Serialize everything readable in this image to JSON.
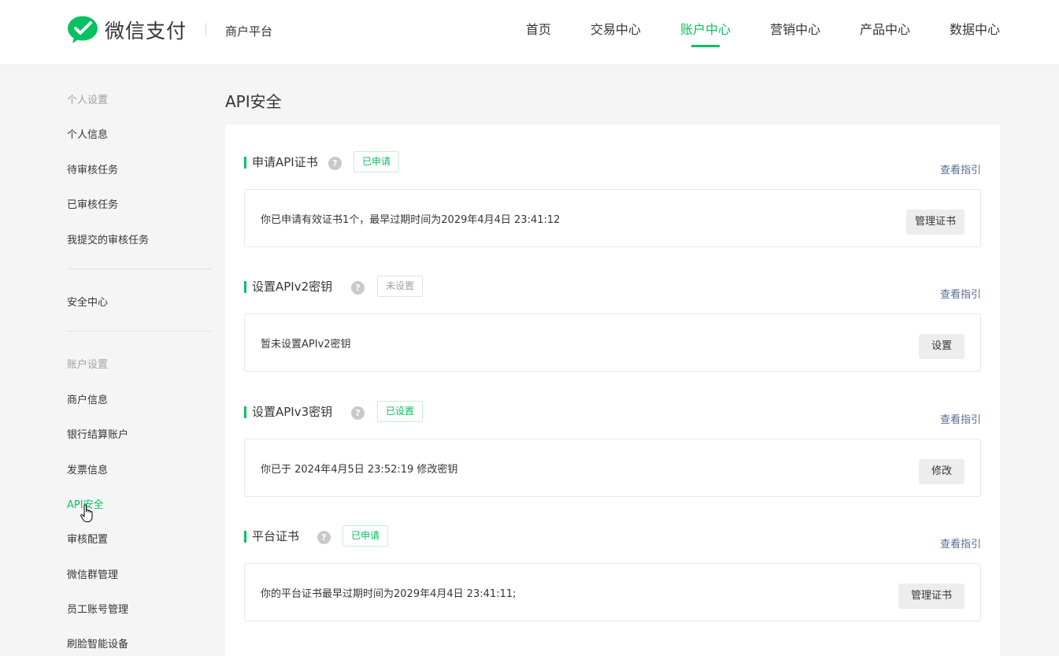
{
  "header": {
    "logo_text": "微信支付",
    "platform": "商户平台",
    "nav": [
      {
        "label": "首页"
      },
      {
        "label": "交易中心"
      },
      {
        "label": "账户中心",
        "active": true
      },
      {
        "label": "营销中心"
      },
      {
        "label": "产品中心"
      },
      {
        "label": "数据中心"
      }
    ]
  },
  "sidebar": {
    "personal_title": "个人设置",
    "personal_items": [
      "个人信息",
      "待审核任务",
      "已审核任务",
      "我提交的审核任务"
    ],
    "security_center": "安全中心",
    "account_title": "账户设置",
    "account_items": [
      "商户信息",
      "银行结算账户",
      "发票信息",
      "API安全",
      "审核配置",
      "微信群管理",
      "员工账号管理",
      "刷脸智能设备"
    ],
    "active_item": "API安全"
  },
  "main": {
    "page_title": "API安全",
    "guide_label": "查看指引",
    "sections": [
      {
        "title": "申请API证书",
        "status": "已申请",
        "text": "你已申请有效证书1个，最早过期时间为2029年4月4日 23:41:12",
        "button": "管理证书"
      },
      {
        "title": "设置APIv2密钥",
        "status": "未设置",
        "text": "暂未设置APIv2密钥",
        "button": "设置"
      },
      {
        "title": "设置APIv3密钥",
        "status": "已设置",
        "text": "你已于 2024年4月5日 23:52:19 修改密钥",
        "button": "修改"
      },
      {
        "title": "平台证书",
        "status": "已申请",
        "text": "你的平台证书最早过期时间为2029年4月4日 23:41:11;",
        "button": "管理证书"
      }
    ]
  },
  "colors": {
    "brand_green": "#07c160",
    "link_blue": "#576b95",
    "page_bg": "#f5f5f5"
  },
  "icons": [
    "wechat-pay-logo-icon",
    "question-circle-icon",
    "hand-cursor-icon"
  ]
}
